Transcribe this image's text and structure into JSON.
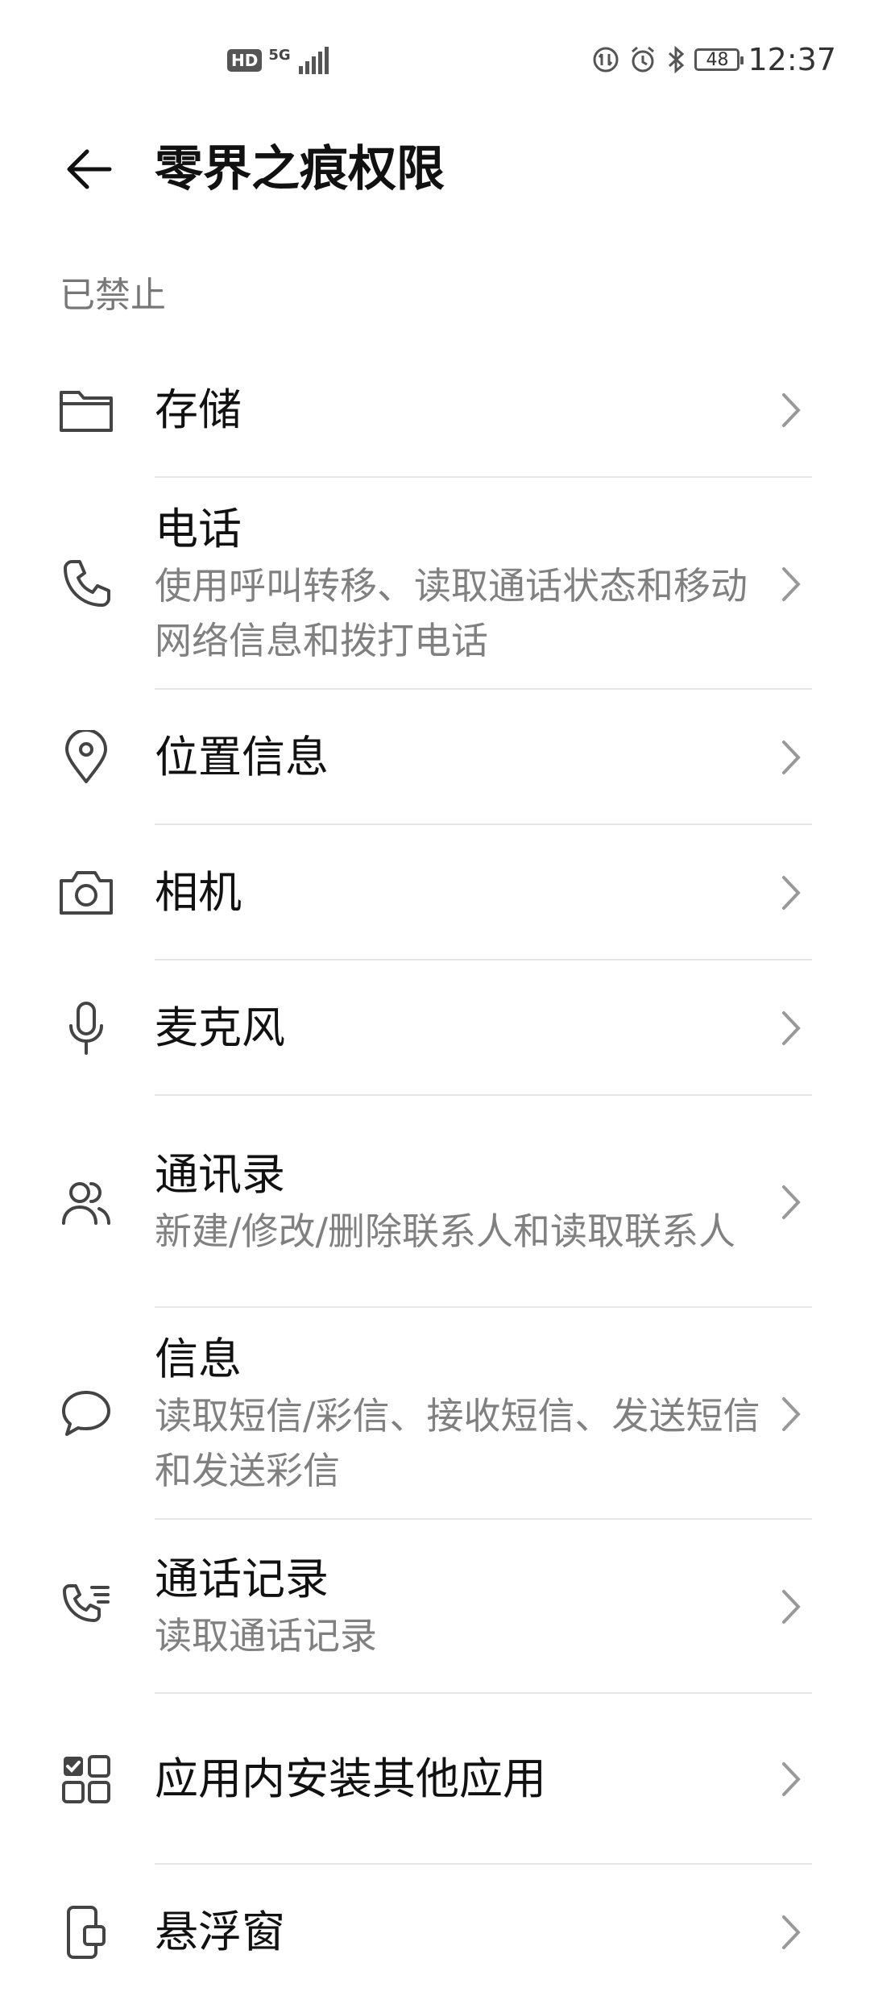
{
  "status_bar": {
    "hd": "HD",
    "network": "5G",
    "battery": "48",
    "time": "12:37"
  },
  "header": {
    "title": "零界之痕权限"
  },
  "section": {
    "label": "已禁止"
  },
  "items": [
    {
      "icon": "folder-icon",
      "title": "存储",
      "desc": ""
    },
    {
      "icon": "phone-icon",
      "title": "电话",
      "desc": "使用呼叫转移、读取通话状态和移动网络信息和拨打电话"
    },
    {
      "icon": "location-pin-icon",
      "title": "位置信息",
      "desc": ""
    },
    {
      "icon": "camera-icon",
      "title": "相机",
      "desc": ""
    },
    {
      "icon": "microphone-icon",
      "title": "麦克风",
      "desc": ""
    },
    {
      "icon": "contacts-icon",
      "title": "通讯录",
      "desc": "新建/修改/删除联系人和读取联系人"
    },
    {
      "icon": "message-icon",
      "title": "信息",
      "desc": "读取短信/彩信、接收短信、发送短信和发送彩信"
    },
    {
      "icon": "call-log-icon",
      "title": "通话记录",
      "desc": "读取通话记录"
    },
    {
      "icon": "app-grid-icon",
      "title": "应用内安装其他应用",
      "desc": ""
    },
    {
      "icon": "floating-window-icon",
      "title": "悬浮窗",
      "desc": ""
    }
  ]
}
